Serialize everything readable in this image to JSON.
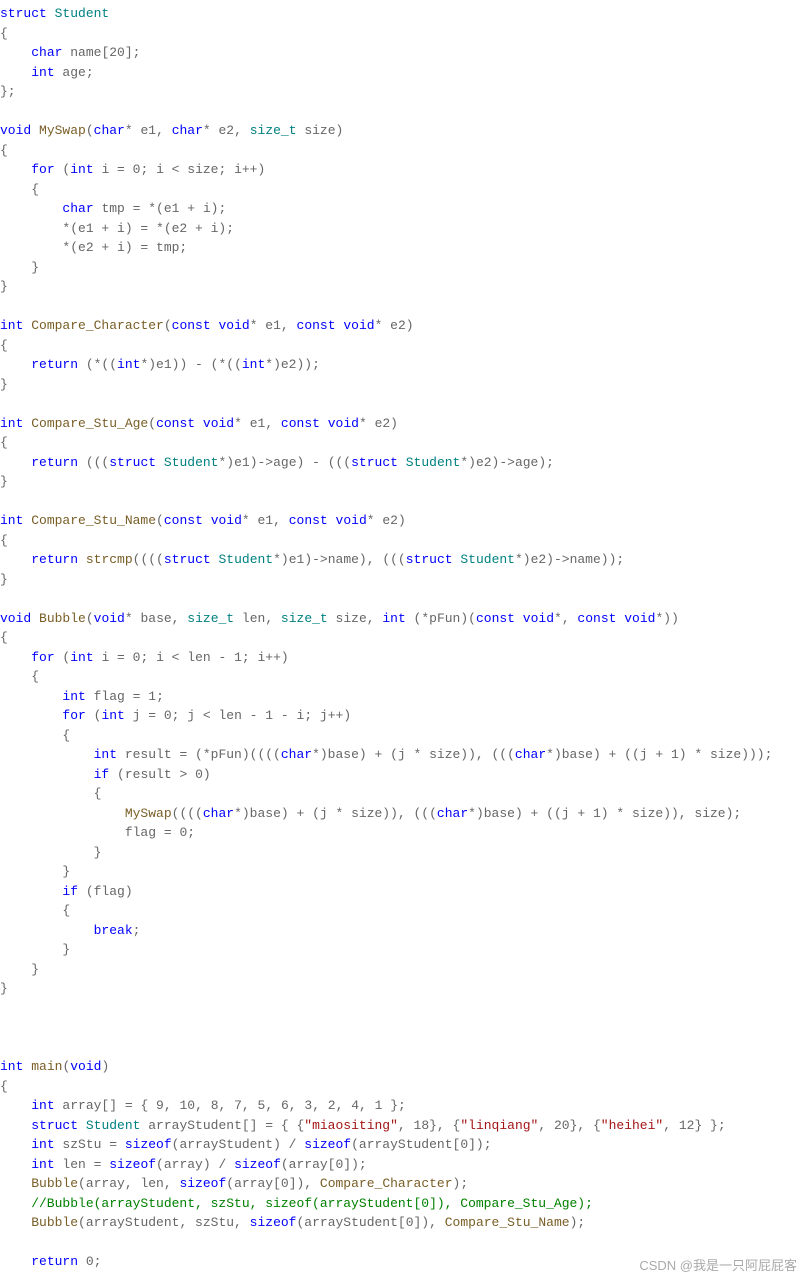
{
  "code": {
    "lines": [
      {
        "t": "struct-decl",
        "text": "struct Student"
      },
      {
        "t": "brace",
        "text": "{"
      },
      {
        "t": "field",
        "text": "    char name[20];"
      },
      {
        "t": "field",
        "text": "    int age;"
      },
      {
        "t": "brace",
        "text": "};"
      },
      {
        "t": "blank",
        "text": ""
      },
      {
        "t": "func-decl",
        "text": "void MySwap(char* e1, char* e2, size_t size)"
      },
      {
        "t": "brace",
        "text": "{"
      },
      {
        "t": "stmt",
        "text": "    for (int i = 0; i < size; i++)"
      },
      {
        "t": "brace",
        "text": "    {"
      },
      {
        "t": "stmt",
        "text": "        char tmp = *(e1 + i);"
      },
      {
        "t": "stmt",
        "text": "        *(e1 + i) = *(e2 + i);"
      },
      {
        "t": "stmt",
        "text": "        *(e2 + i) = tmp;"
      },
      {
        "t": "brace",
        "text": "    }"
      },
      {
        "t": "brace",
        "text": "}"
      },
      {
        "t": "blank",
        "text": ""
      },
      {
        "t": "func-decl",
        "text": "int Compare_Character(const void* e1, const void* e2)"
      },
      {
        "t": "brace",
        "text": "{"
      },
      {
        "t": "stmt",
        "text": "    return (*((int*)e1)) - (*((int*)e2));"
      },
      {
        "t": "brace",
        "text": "}"
      },
      {
        "t": "blank",
        "text": ""
      },
      {
        "t": "func-decl",
        "text": "int Compare_Stu_Age(const void* e1, const void* e2)"
      },
      {
        "t": "brace",
        "text": "{"
      },
      {
        "t": "stmt",
        "text": "    return (((struct Student*)e1)->age) - (((struct Student*)e2)->age);"
      },
      {
        "t": "brace",
        "text": "}"
      },
      {
        "t": "blank",
        "text": ""
      },
      {
        "t": "func-decl",
        "text": "int Compare_Stu_Name(const void* e1, const void* e2)"
      },
      {
        "t": "brace",
        "text": "{"
      },
      {
        "t": "stmt",
        "text": "    return strcmp((((struct Student*)e1)->name), (((struct Student*)e2)->name));"
      },
      {
        "t": "brace",
        "text": "}"
      },
      {
        "t": "blank",
        "text": ""
      },
      {
        "t": "func-decl",
        "text": "void Bubble(void* base, size_t len, size_t size, int (*pFun)(const void*, const void*))"
      },
      {
        "t": "brace",
        "text": "{"
      },
      {
        "t": "stmt",
        "text": "    for (int i = 0; i < len - 1; i++)"
      },
      {
        "t": "brace",
        "text": "    {"
      },
      {
        "t": "stmt",
        "text": "        int flag = 1;"
      },
      {
        "t": "stmt",
        "text": "        for (int j = 0; j < len - 1 - i; j++)"
      },
      {
        "t": "brace",
        "text": "        {"
      },
      {
        "t": "stmt",
        "text": "            int result = (*pFun)((((char*)base) + (j * size)), (((char*)base) + ((j + 1) * size)));"
      },
      {
        "t": "stmt",
        "text": "            if (result > 0)"
      },
      {
        "t": "brace",
        "text": "            {"
      },
      {
        "t": "stmt",
        "text": "                MySwap((((char*)base) + (j * size)), (((char*)base) + ((j + 1) * size)), size);"
      },
      {
        "t": "stmt",
        "text": "                flag = 0;"
      },
      {
        "t": "brace",
        "text": "            }"
      },
      {
        "t": "brace",
        "text": "        }"
      },
      {
        "t": "stmt",
        "text": "        if (flag)"
      },
      {
        "t": "brace",
        "text": "        {"
      },
      {
        "t": "stmt",
        "text": "            break;"
      },
      {
        "t": "brace",
        "text": "        }"
      },
      {
        "t": "brace",
        "text": "    }"
      },
      {
        "t": "brace",
        "text": "}"
      },
      {
        "t": "blank",
        "text": ""
      },
      {
        "t": "blank",
        "text": ""
      },
      {
        "t": "blank",
        "text": ""
      },
      {
        "t": "func-decl",
        "text": "int main(void)"
      },
      {
        "t": "brace",
        "text": "{"
      },
      {
        "t": "stmt",
        "text": "    int array[] = { 9, 10, 8, 7, 5, 6, 3, 2, 4, 1 };"
      },
      {
        "t": "stmt",
        "text": "    struct Student arrayStudent[] = { {\"miaositing\", 18}, {\"linqiang\", 20}, {\"heihei\", 12} };"
      },
      {
        "t": "stmt",
        "text": "    int szStu = sizeof(arrayStudent) / sizeof(arrayStudent[0]);"
      },
      {
        "t": "stmt",
        "text": "    int len = sizeof(array) / sizeof(array[0]);"
      },
      {
        "t": "stmt",
        "text": "    Bubble(array, len, sizeof(array[0]), Compare_Character);"
      },
      {
        "t": "comment",
        "text": "    //Bubble(arrayStudent, szStu, sizeof(arrayStudent[0]), Compare_Stu_Age);"
      },
      {
        "t": "stmt",
        "text": "    Bubble(arrayStudent, szStu, sizeof(arrayStudent[0]), Compare_Stu_Name);"
      },
      {
        "t": "blank",
        "text": ""
      },
      {
        "t": "stmt",
        "text": "    return 0;"
      }
    ]
  },
  "watermark": "CSDN @我是一只阿屁屁客",
  "syntax": {
    "keywords": [
      "struct",
      "char",
      "int",
      "void",
      "const",
      "for",
      "if",
      "return",
      "break",
      "sizeof"
    ],
    "types": [
      "Student",
      "size_t"
    ],
    "functions": [
      "MySwap",
      "Compare_Character",
      "Compare_Stu_Age",
      "Compare_Stu_Name",
      "Bubble",
      "strcmp",
      "main"
    ]
  }
}
